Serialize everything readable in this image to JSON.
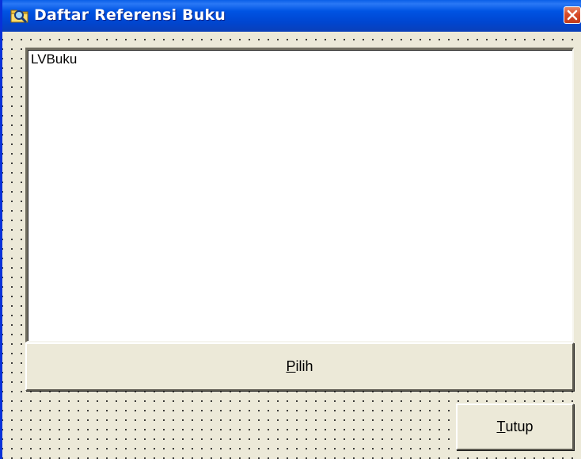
{
  "window": {
    "title": "Daftar Referensi Buku",
    "app_icon": "folder-search-icon",
    "close_icon": "close-icon"
  },
  "listview": {
    "caption": "LVBuku"
  },
  "buttons": {
    "pilih": {
      "accel": "P",
      "rest": "ilih"
    },
    "tutup": {
      "accel": "T",
      "rest": "utup"
    }
  },
  "colors": {
    "titlebar": "#0054e3",
    "form_background": "#ece9d8",
    "close_button": "#d84a28"
  }
}
